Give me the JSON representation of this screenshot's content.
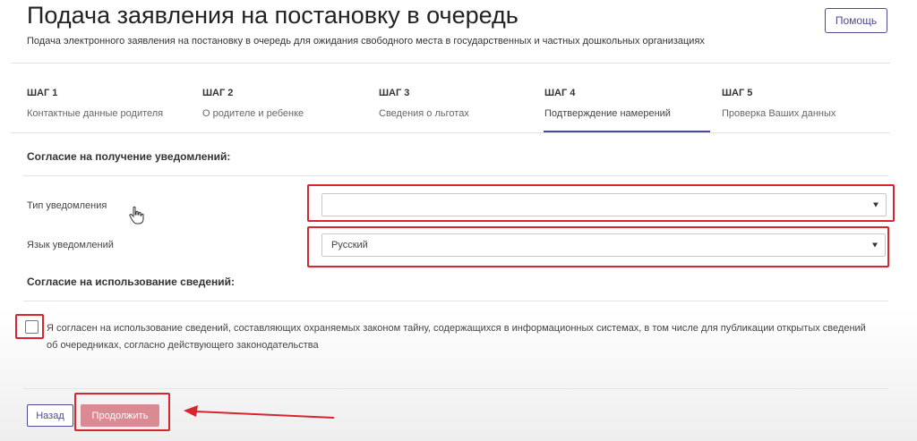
{
  "header": {
    "title": "Подача заявления на постановку в очередь",
    "subtitle": "Подача электронного заявления на постановку в очередь для ожидания свободного места в государственных и частных дошкольных организациях",
    "help_label": "Помощь"
  },
  "steps": [
    {
      "num": "ШАГ 1",
      "label": "Контактные данные родителя",
      "active": false
    },
    {
      "num": "ШАГ 2",
      "label": "О родителе и ребенке",
      "active": false
    },
    {
      "num": "ШАГ 3",
      "label": "Сведения о льготах",
      "active": false
    },
    {
      "num": "ШАГ 4",
      "label": "Подтверждение намерений",
      "active": true
    },
    {
      "num": "ШАГ 5",
      "label": "Проверка Ваших данных",
      "active": false
    }
  ],
  "notifications": {
    "section_title": "Согласие на получение уведомлений:",
    "type_label": "Тип уведомления",
    "type_value": "",
    "language_label": "Язык уведомлений",
    "language_value": "Русский"
  },
  "consent": {
    "section_title": "Согласие на использование сведений:",
    "checked": false,
    "text": "Я согласен на использование сведений, составляющих охраняемых законом тайну, содержащихся в информационных системах, в том числе для публикации открытых сведений об очередниках, согласно действующего законодательства"
  },
  "actions": {
    "back_label": "Назад",
    "continue_label": "Продолжить",
    "continue_disabled": true
  },
  "colors": {
    "accent": "#4b4b8f",
    "annotation_red": "#d7262e",
    "disabled_button": "#d98a93"
  }
}
